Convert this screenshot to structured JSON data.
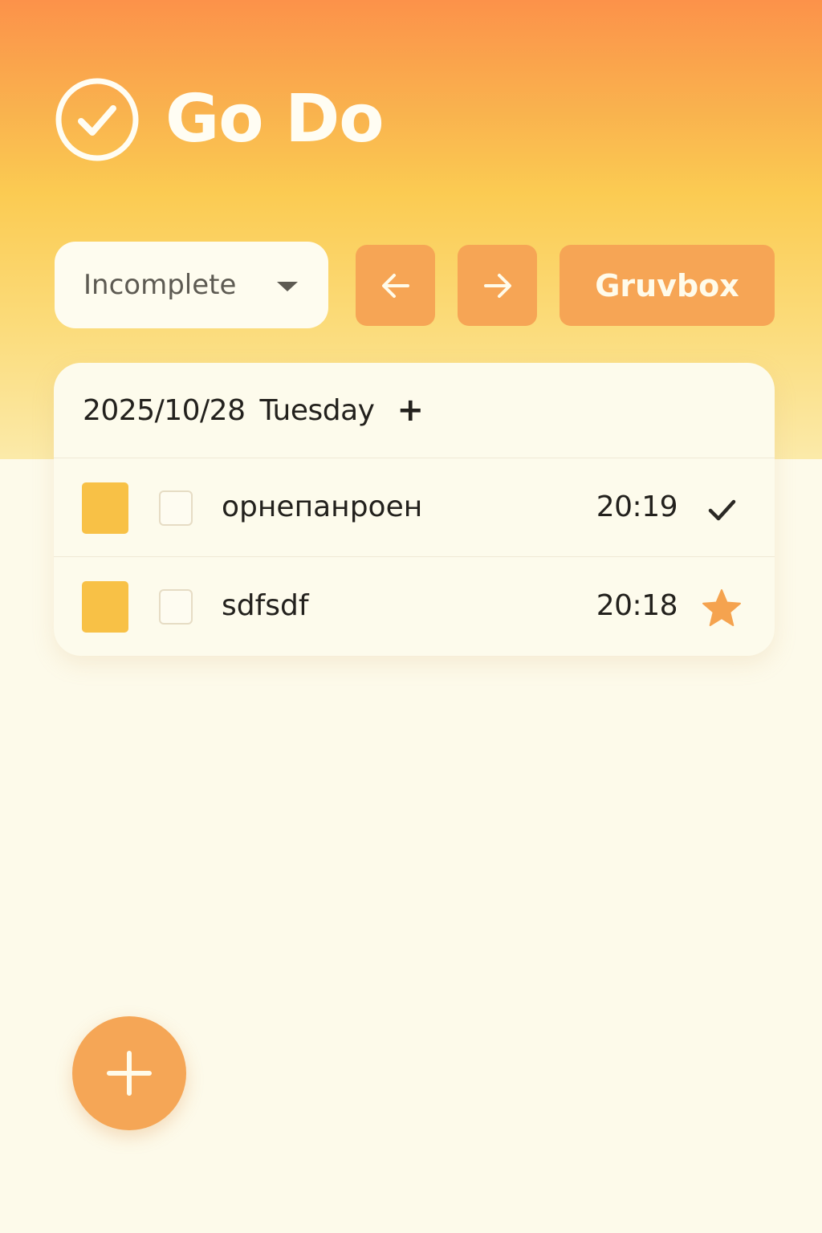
{
  "app": {
    "title": "Go Do"
  },
  "toolbar": {
    "filter_value": "Incomplete",
    "prev_icon": "arrow-left-icon",
    "next_icon": "arrow-right-icon",
    "theme_label": "Gruvbox"
  },
  "day": {
    "date": "2025/10/28",
    "weekday": "Tuesday",
    "add_label": "+"
  },
  "tasks": [
    {
      "title": "орнепанроен",
      "time": "20:19",
      "color": "#f8c146",
      "checked": false,
      "action_icon": "checkmark-icon"
    },
    {
      "title": "sdfsdf",
      "time": "20:18",
      "color": "#f8c146",
      "checked": false,
      "action_icon": "star-icon"
    }
  ],
  "colors": {
    "accent": "#f6a555",
    "header_gradient_top": "#fc924a",
    "header_gradient_bottom": "#fbeaa9",
    "background": "#fdfaea",
    "text": "#23211d"
  },
  "fab": {
    "icon": "plus-icon"
  }
}
